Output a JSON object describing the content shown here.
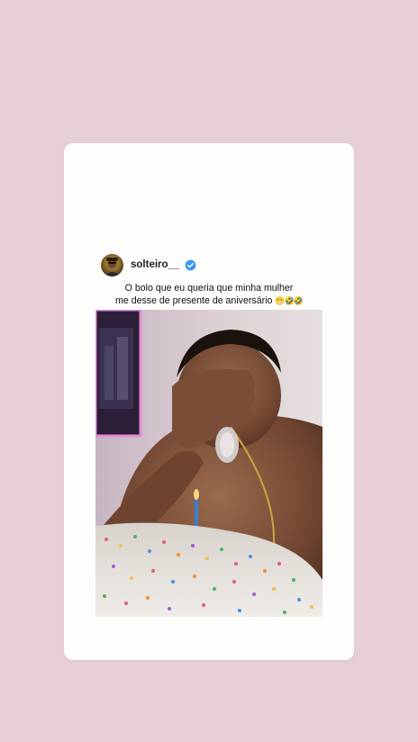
{
  "colors": {
    "page_background": "#e8cfd6",
    "card_background": "#fdfdfc",
    "verified_badge": "#3897f0"
  },
  "post": {
    "username": "solteiro__",
    "verified": true,
    "avatar_icon": "avatar-icon",
    "caption_line1": "O bolo que eu queria que minha mulher",
    "caption_line2": "me desse de presente de aniversário",
    "caption_emojis": "😬🤣🤣"
  }
}
